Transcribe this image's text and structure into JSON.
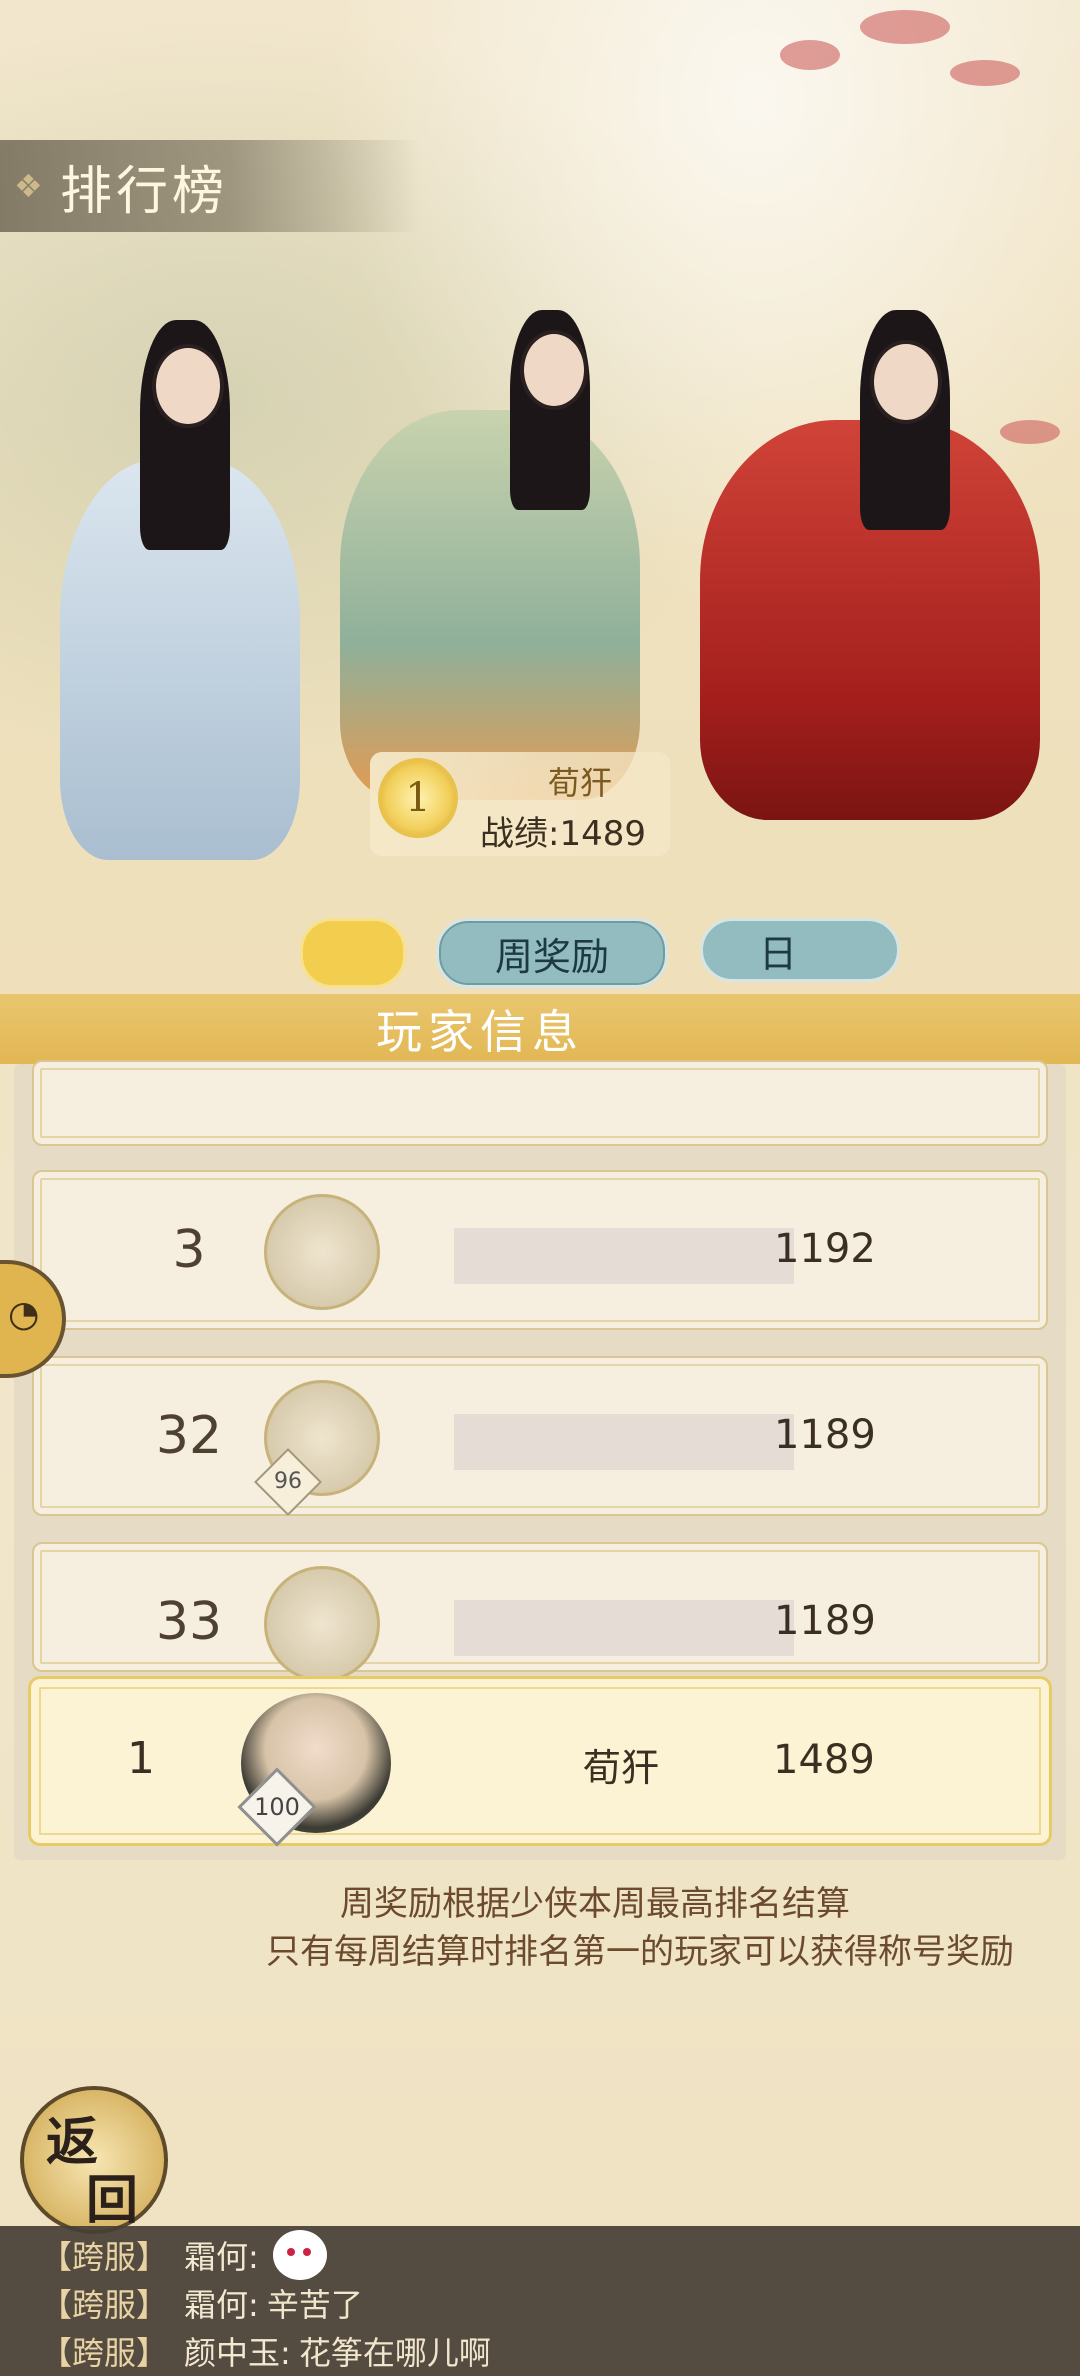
{
  "screen": {
    "title": "排行榜",
    "title_icon": "ornament-icon"
  },
  "top_rank": {
    "rank": "1",
    "name": "荀犴",
    "score_text": "战绩:1489"
  },
  "tabs": {
    "weekly": "周奖励",
    "daily": "日"
  },
  "section": {
    "title": "玩家信息"
  },
  "rows": [
    {
      "rank": "",
      "level": "",
      "score": ""
    },
    {
      "rank": "3",
      "level": "",
      "score": "1192"
    },
    {
      "rank": "32",
      "level": "96",
      "score": "1189"
    },
    {
      "rank": "33",
      "level": "",
      "score": "1189"
    }
  ],
  "self_row": {
    "rank": "1",
    "level": "100",
    "name": "荀犴",
    "score": "1489"
  },
  "notes": {
    "line1": "周奖励根据少侠本周最高排名结算",
    "line2": "只有每周结算时排名第一的玩家可以获得称号奖励"
  },
  "back_button": {
    "char1": "返",
    "char2": "回"
  },
  "chat": [
    {
      "tag": "【跨服】",
      "who": "霜何:",
      "text": "",
      "emoji": "blush-emoji-icon"
    },
    {
      "tag": "【跨服】",
      "who": "霜何:",
      "text": "辛苦了"
    },
    {
      "tag": "【跨服】",
      "who": "颜中玉:",
      "text": "花筝在哪儿啊"
    }
  ],
  "colors": {
    "accent_gold": "#e2b754",
    "tab_teal": "#93bcc0",
    "chat_bg": "#463e36"
  }
}
